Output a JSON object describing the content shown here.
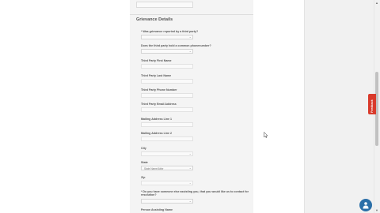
{
  "section": {
    "title": "Grievance Details"
  },
  "fields": {
    "represented_by_third_party": {
      "label": "* Was grievance reported by a third party?"
    },
    "third_party_union": {
      "label": "Does the third party hold a common phonenumber?"
    },
    "third_party_first_name": {
      "label": "Third Party First Name"
    },
    "third_party_last_name": {
      "label": "Third Party Last Name"
    },
    "third_party_phone": {
      "label": "Third Party Phone Number"
    },
    "third_party_email": {
      "label": "Third Party Email Address"
    },
    "mailing_address_1": {
      "label": "Mailing Address Line 1"
    },
    "mailing_address_2": {
      "label": "Mailing Address Line 2"
    },
    "city": {
      "label": "City"
    },
    "state": {
      "label": "State",
      "value": "State Name/Abbr"
    },
    "zip": {
      "label": "Zip"
    },
    "contact_question": {
      "label": "* Do you have someone else assisting you, that you would like us to contact for resolution?"
    },
    "person_assisting_name": {
      "label": "Person Assisting Name"
    }
  },
  "feedback": {
    "label": "Feedback"
  },
  "icons": {
    "help": "chat-help-icon",
    "scroll_up": "scroll-up-arrow-icon",
    "scroll_down": "scroll-down-arrow-icon"
  },
  "colors": {
    "feedback": "#d93a2b",
    "help_button": "#2b6fa8",
    "panel": "#f4f4f4"
  }
}
